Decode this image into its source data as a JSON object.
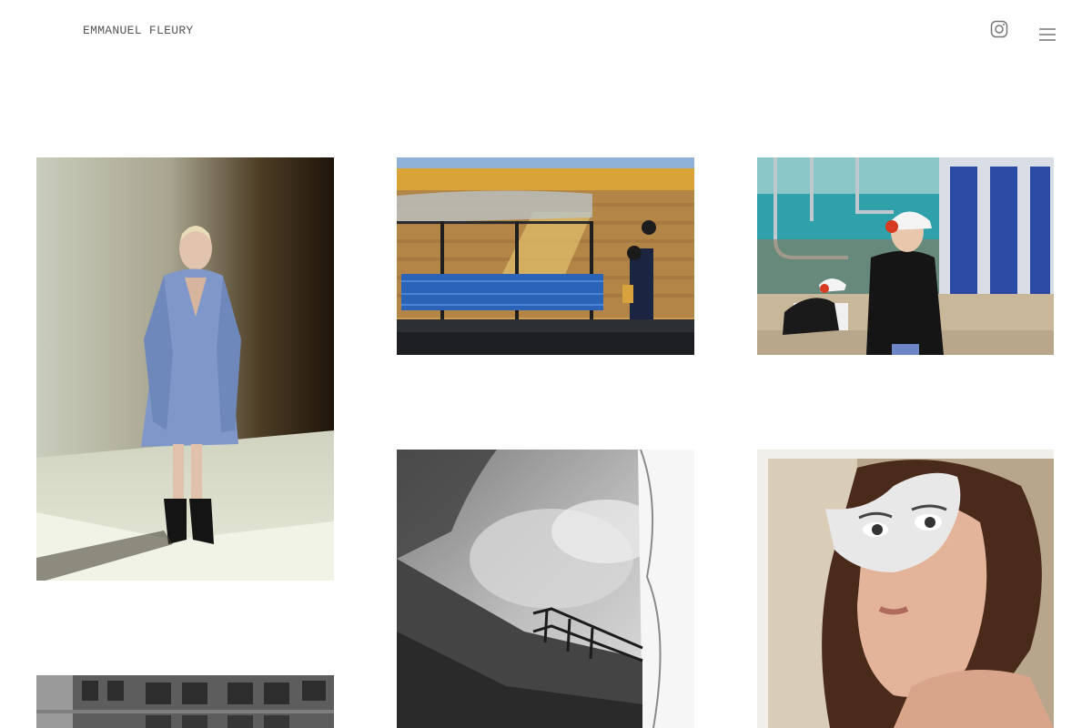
{
  "header": {
    "site_title": "EMMANUEL FLEURY",
    "instagram_icon": "instagram-icon",
    "menu_icon": "hamburger-menu-icon"
  },
  "gallery": {
    "items": [
      {
        "name": "photo-fashion-blue-dress"
      },
      {
        "name": "photo-bus-shelter-carts"
      },
      {
        "name": "photo-factory-workers"
      },
      {
        "name": "photo-bw-sky-railing"
      },
      {
        "name": "photo-collage-portrait"
      },
      {
        "name": "photo-bw-building-facade"
      }
    ]
  },
  "colors": {
    "background": "#ffffff",
    "title_text": "#555555",
    "icon_stroke": "#777777"
  }
}
